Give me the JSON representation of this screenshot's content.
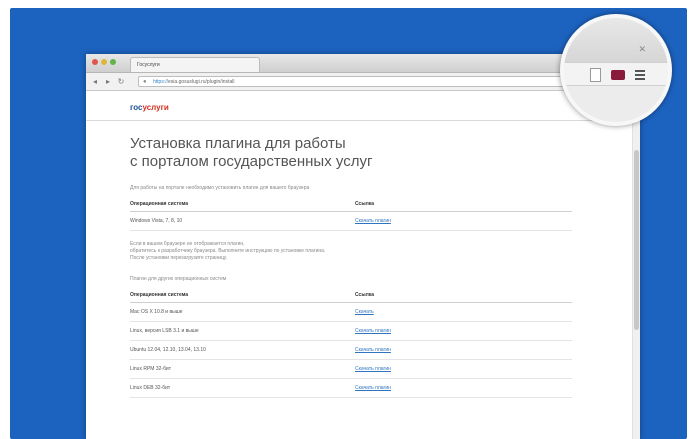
{
  "colors": {
    "panel_bg": "#1c63c0",
    "link": "#2f74bf",
    "logo_primary": "#1a4f9c",
    "logo_accent": "#d4301f"
  },
  "browser": {
    "tab_title": "Госуслуги",
    "url_domain": "https://",
    "url_path": "esia.gosuslugi.ru/plugin/install"
  },
  "page": {
    "logo_part1": "гос",
    "logo_part2": "услуги",
    "title_line1": "Установка плагина для работы",
    "title_line2": "с порталом государственных услуг",
    "intro": "Для работы на портале необходимо установить плагин для вашего браузера",
    "table1": {
      "headers": [
        "Операционная система",
        "Ссылка"
      ],
      "rows": [
        [
          "Windows Vista, 7, 8, 10",
          "Скачать плагин"
        ]
      ]
    },
    "note_lines": [
      "Если в вашем браузере не отображается плагин,",
      "обратитесь к разработчику браузера. Выполните инструкцию по установке плагина.",
      "После установки перезагрузите страницу."
    ],
    "section2": "Плагин для других операционных систем",
    "table2": {
      "headers": [
        "Операционная система",
        "Ссылка"
      ],
      "rows": [
        [
          "Mac OS X 10.8 и выше",
          "Скачать"
        ],
        [
          "Linux, версия LSB 3.1 и выше",
          "Скачать плагин"
        ],
        [
          "Ubuntu 12.04, 12.10, 13.04, 13.10",
          "Скачать плагин"
        ],
        [
          "Linux RPM 32-бит",
          "Скачать плагин"
        ],
        [
          "Linux DEB 32-бит",
          "Скачать плагин"
        ]
      ]
    }
  },
  "magnifier": {
    "icons": [
      "page-icon",
      "plugin-icon",
      "menu-icon"
    ]
  }
}
